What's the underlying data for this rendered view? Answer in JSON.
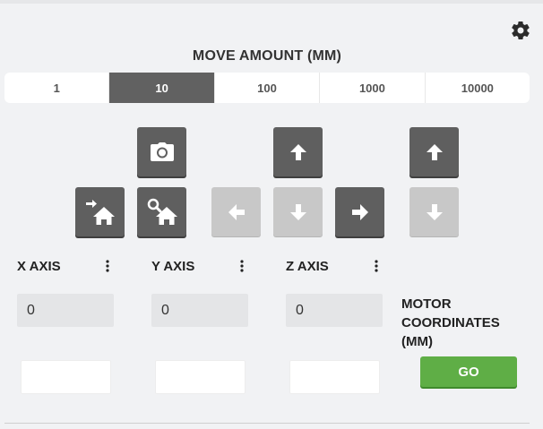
{
  "header": {
    "title": "MOVE AMOUNT (MM)",
    "settings_icon": "gear-icon"
  },
  "move_amount": {
    "options": [
      "1",
      "10",
      "100",
      "1000",
      "10000"
    ],
    "selected": "10"
  },
  "jog_buttons": [
    {
      "name": "camera-button",
      "icon": "camera-icon",
      "enabled": true
    },
    {
      "name": "z-up-button",
      "icon": "arrow-up-icon",
      "enabled": true
    },
    {
      "name": "z2-up-button",
      "icon": "arrow-up-icon",
      "enabled": true
    },
    {
      "name": "go-home-button",
      "icon": "home-arrow-icon",
      "enabled": true
    },
    {
      "name": "find-home-button",
      "icon": "home-search-icon",
      "enabled": true
    },
    {
      "name": "x-left-button",
      "icon": "arrow-left-icon",
      "enabled": false
    },
    {
      "name": "y-down-button",
      "icon": "arrow-down-icon",
      "enabled": false
    },
    {
      "name": "x-right-button",
      "icon": "arrow-right-icon",
      "enabled": true
    },
    {
      "name": "z2-down-button",
      "icon": "arrow-down-icon",
      "enabled": false
    }
  ],
  "axes": [
    {
      "label": "X AXIS",
      "value": "0"
    },
    {
      "label": "Y AXIS",
      "value": "0"
    },
    {
      "label": "Z AXIS",
      "value": "0"
    }
  ],
  "motor_coordinates_label": "MOTOR COORDINATES (MM)",
  "go_label": "GO",
  "colors": {
    "background": "#f1f2f4",
    "button_dark": "#5f5f5f",
    "button_disabled": "#c8c8c8",
    "segment_active": "#616161",
    "go_green": "#5fae46"
  }
}
